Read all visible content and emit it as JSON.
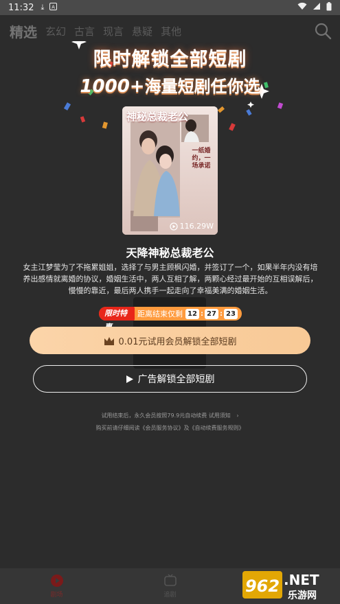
{
  "status_bar": {
    "time": "11:32"
  },
  "app_bar": {
    "tabs": [
      {
        "label": "精选",
        "active": true
      },
      {
        "label": "玄幻",
        "active": false
      },
      {
        "label": "古言",
        "active": false
      },
      {
        "label": "现言",
        "active": false
      },
      {
        "label": "悬疑",
        "active": false
      },
      {
        "label": "其他",
        "active": false
      }
    ]
  },
  "promo": {
    "title": "限时解锁全部短剧",
    "subtitle_number": "1000+",
    "subtitle_text": "海量短剧任你选"
  },
  "poster": {
    "cover_title": "神秘总裁老公",
    "cover_tagline": "一纸婚约，一场承诺",
    "views": "116.29W"
  },
  "drama": {
    "title": "天降神秘总裁老公",
    "description": "女主江梦莹为了不拖累姐姐，选择了与男主顾枫闪婚，并签订了一个，如果半年内没有培养出感情就离婚的协议，婚姻生活中，两人互相了解，两颗心经过最开始的互相误解后，慢慢的靠近，最后两人携手一起走向了幸福美满的婚姻生活。"
  },
  "deal": {
    "label": "限时特惠",
    "text": "距离结束仅剩",
    "countdown": {
      "h": "12",
      "m": "27",
      "s": "23"
    }
  },
  "buttons": {
    "vip": "0.01元试用会员解锁全部短剧",
    "ad": "广告解锁全部短剧"
  },
  "terms": {
    "line1": "试用结束后，永久会员按照79.9元自动续费 试用须知",
    "line2": "购买前请仔细阅读《会员服务协议》及《自动续费服务规则》"
  },
  "bottom_nav": [
    {
      "label": "剧场"
    },
    {
      "label": "追剧"
    }
  ],
  "watermark": {
    "brand": "962.NET",
    "sub": "乐游网"
  },
  "colors": {
    "vip_button": "#f8c996",
    "deal_tag": "#ff9b3e",
    "deal_label": "#e8261a"
  }
}
